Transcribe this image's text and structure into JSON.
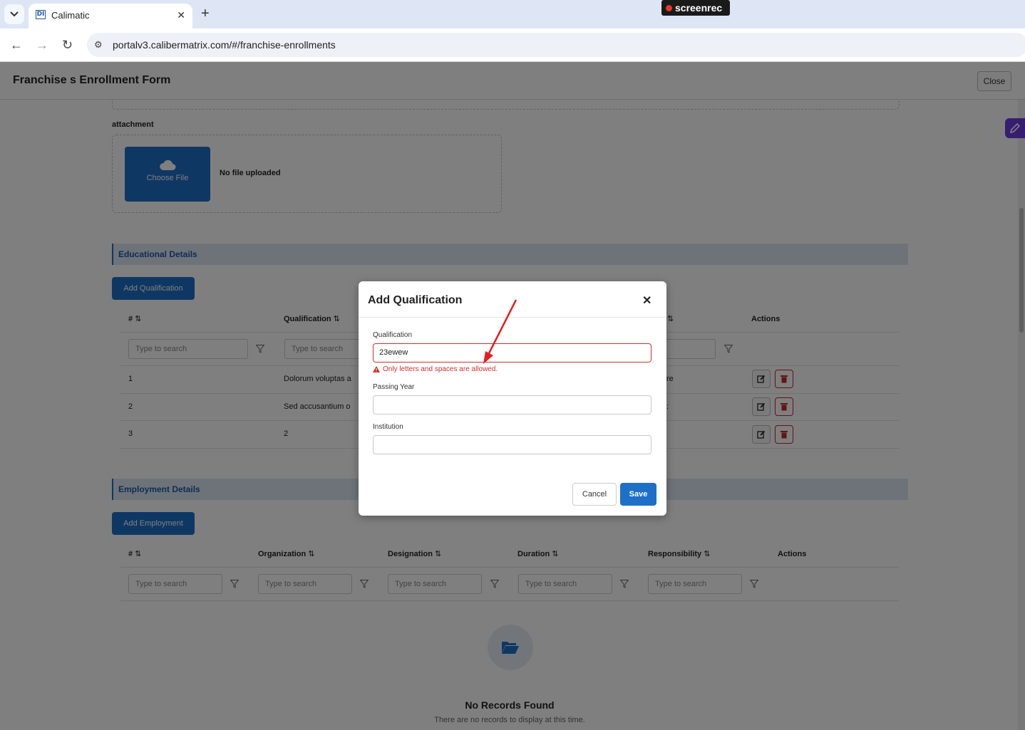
{
  "browser": {
    "tab_title": "Calimatic",
    "favicon_text": "DI",
    "url": "portalv3.calibermatrix.com/#/franchise-enrollments",
    "recorder_label": "screenrec"
  },
  "page": {
    "title": "Franchise s Enrollment Form",
    "close_label": "Close"
  },
  "attachment": {
    "label": "attachment",
    "choose_label": "Choose File",
    "status": "No file uploaded"
  },
  "education": {
    "section_title": "Educational Details",
    "add_button": "Add Qualification",
    "columns": [
      "#",
      "Qualification",
      "",
      "Actions"
    ],
    "search_placeholder": "Type to search",
    "rows": [
      {
        "num": "1",
        "qualification": "Dolorum voluptas a",
        "extra": "re"
      },
      {
        "num": "2",
        "qualification": "Sed accusantium o",
        "extra": ":"
      },
      {
        "num": "3",
        "qualification": "2",
        "extra": ""
      }
    ]
  },
  "employment": {
    "section_title": "Employment Details",
    "add_button": "Add Employment",
    "columns": [
      "#",
      "Organization",
      "Designation",
      "Duration",
      "Responsibility",
      "Actions"
    ],
    "search_placeholder": "Type to search",
    "empty_title": "No Records Found",
    "empty_subtitle": "There are no records to display at this time."
  },
  "modal": {
    "title": "Add Qualification",
    "qualification_label": "Qualification",
    "qualification_value": "23ewew",
    "error_text": "Only letters and spaces are allowed.",
    "passing_year_label": "Passing Year",
    "passing_year_value": "",
    "institution_label": "Institution",
    "institution_value": "",
    "cancel_label": "Cancel",
    "save_label": "Save"
  },
  "colors": {
    "primary": "#1e6fc8",
    "error": "#d32f2f",
    "section_band": "#dde7f4",
    "annotation_arrow": "#e32020"
  }
}
